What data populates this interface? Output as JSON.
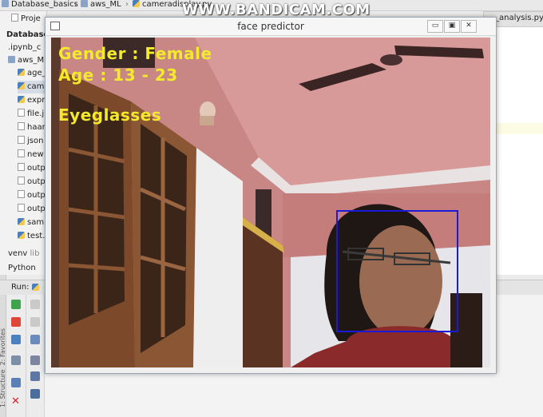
{
  "ide": {
    "breadcrumbs": [
      "Database_basics",
      "aws_ML",
      "cameradisplay.py"
    ],
    "project_tab": "Proje",
    "project_root": "Database_b",
    "tree": [
      ".ipynb_c",
      "aws_ML",
      "age_",
      "cam",
      "expr",
      "file.j",
      "haar",
      "json",
      "new",
      "outp",
      "outp",
      "outp",
      "outp",
      "sam",
      "test.",
      "venv",
      "Python"
    ],
    "venv_suffix": "lib",
    "right_tab": "_analysis.py",
    "run_label": "Run:",
    "side_labels": [
      "1: Structure",
      "2: Favorites"
    ]
  },
  "watermark": "WWW.BANDICAM.COM",
  "window": {
    "title": "face predictor",
    "buttons": {
      "minimize": "▭",
      "restore": "▣",
      "close": "✕"
    },
    "overlay": {
      "gender": "Gender : Female",
      "age": "Age : 13 - 23",
      "attribute": "Eyeglasses"
    },
    "face_box_color": "#1a1ad8",
    "overlay_color": "#f2ea2b"
  }
}
